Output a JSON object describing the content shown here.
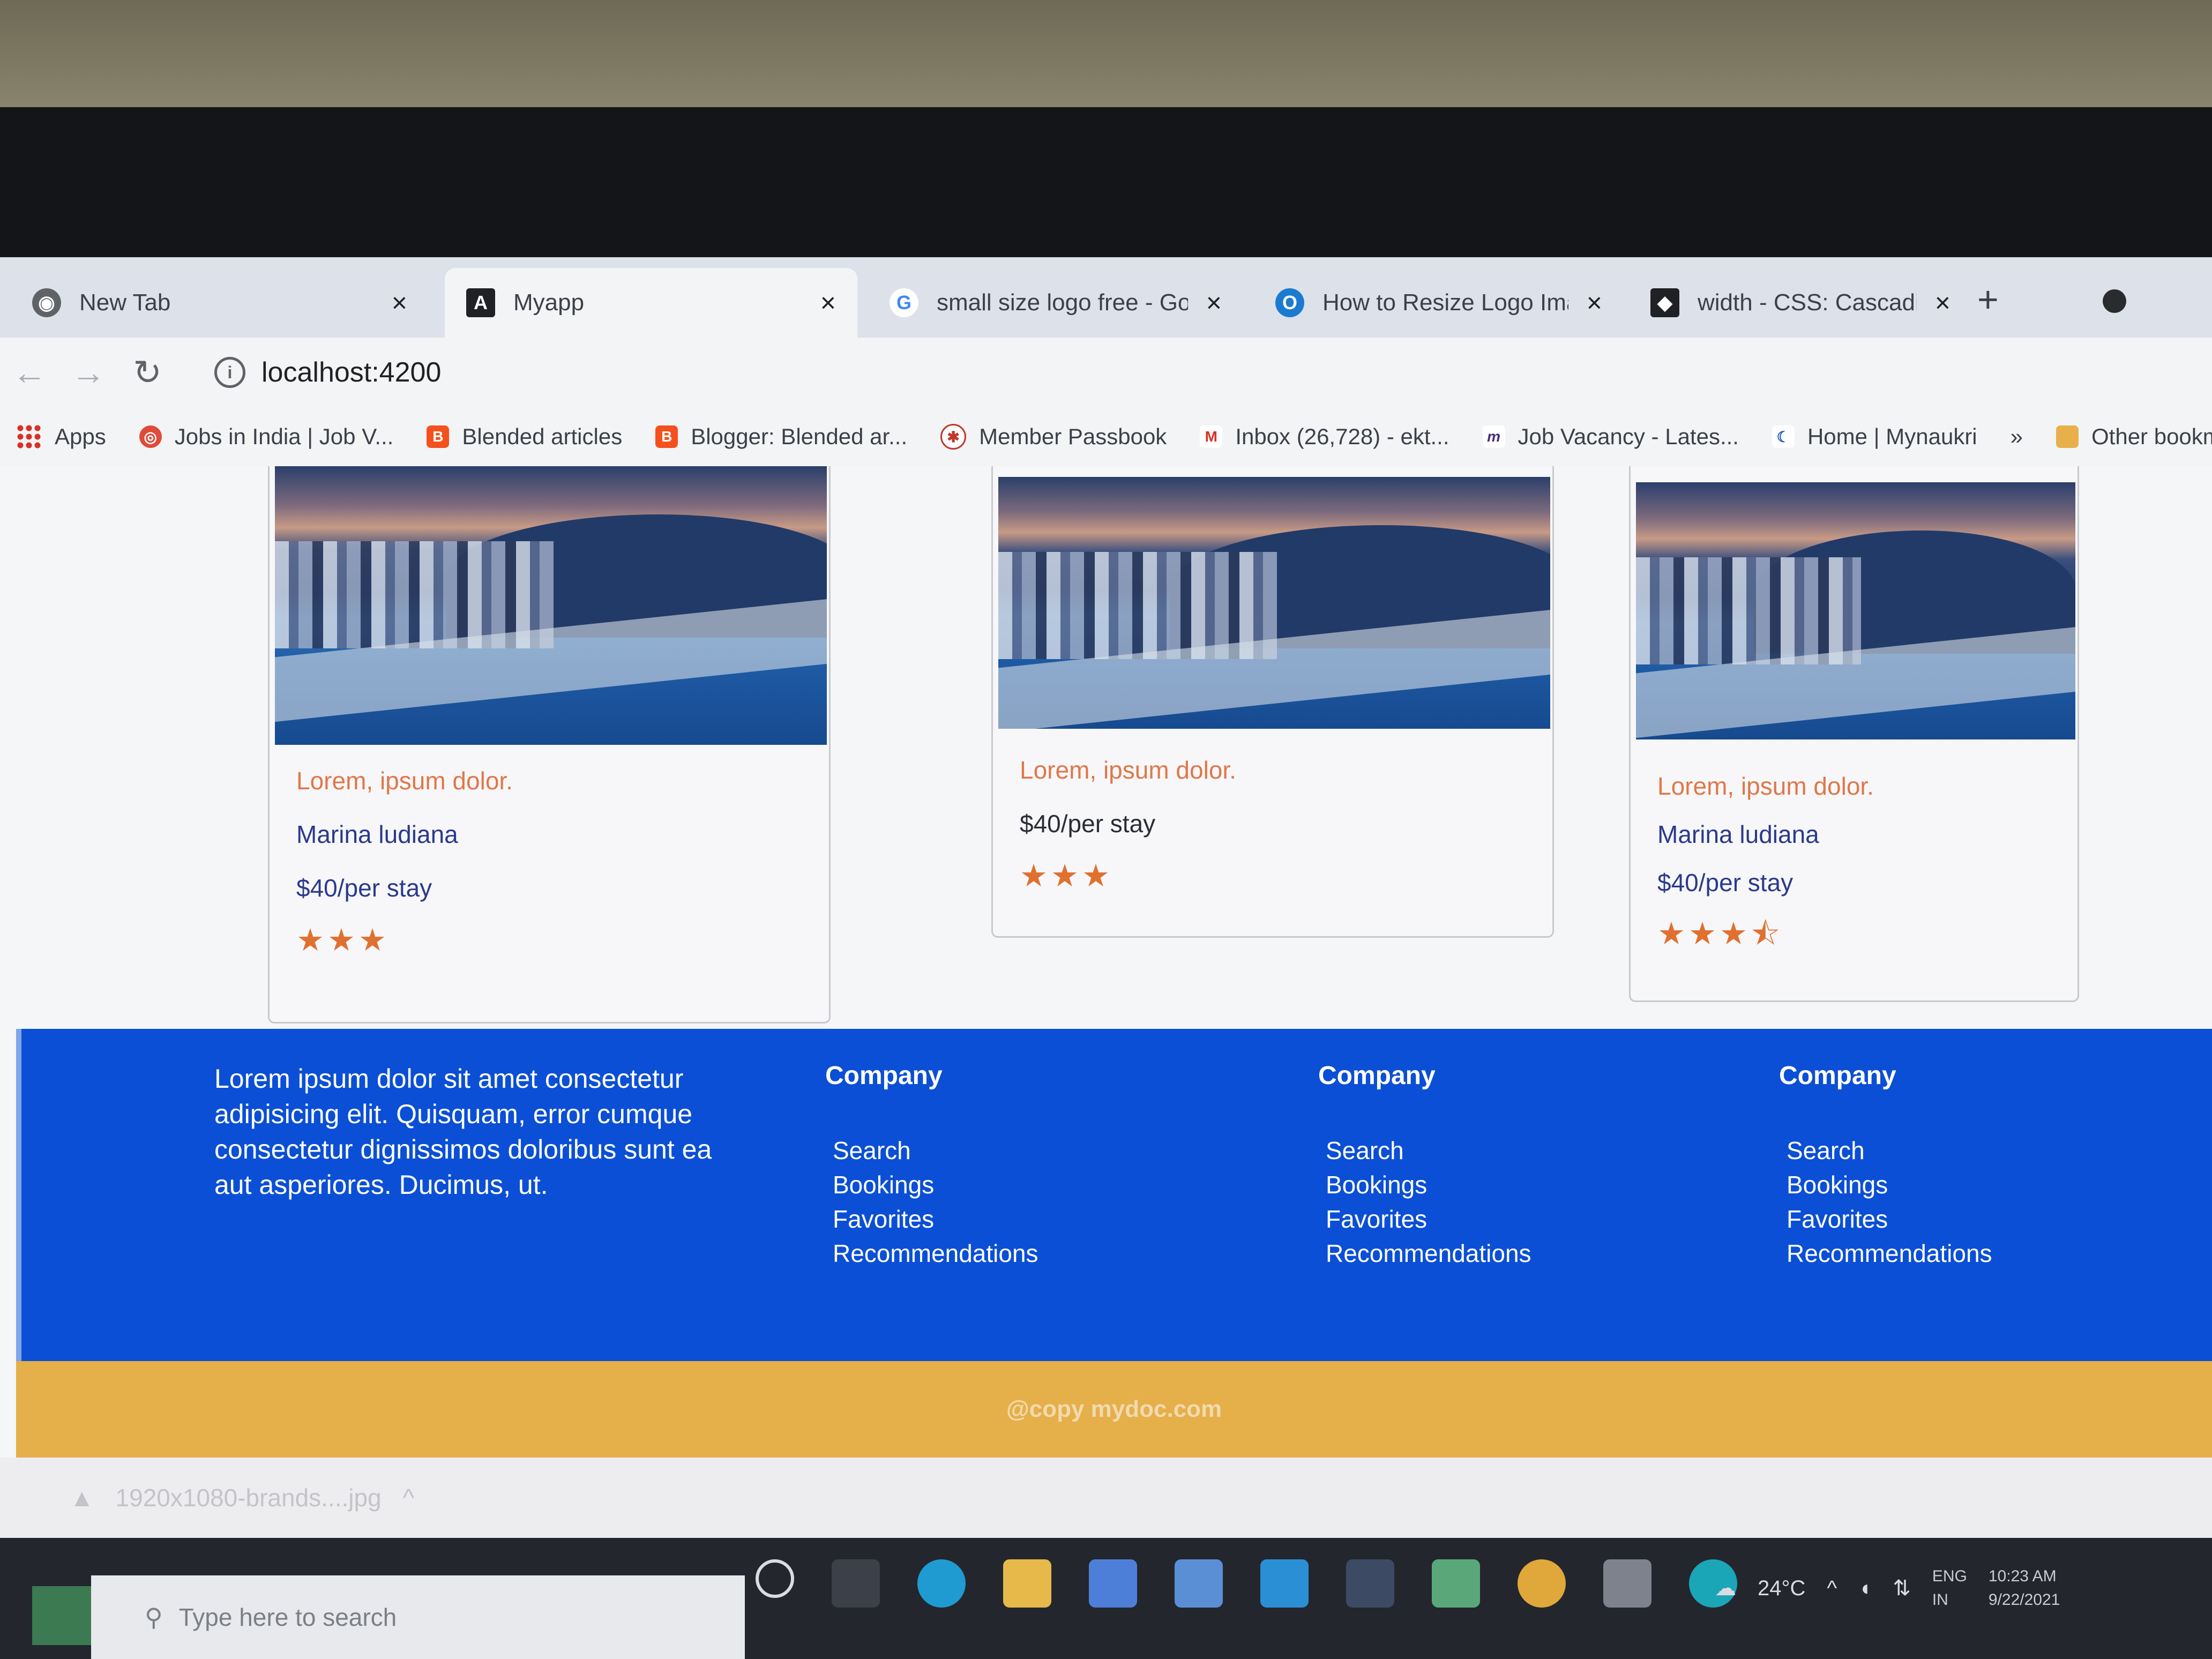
{
  "browser": {
    "tabs": [
      {
        "title": "New Tab",
        "icon": "chrome-icon",
        "active": false
      },
      {
        "title": "Myapp",
        "icon": "angular-icon",
        "active": true
      },
      {
        "title": "small size logo free - Google",
        "icon": "google-icon",
        "active": false
      },
      {
        "title": "How to Resize Logo Image in",
        "icon": "site-icon",
        "active": false
      },
      {
        "title": "width - CSS: Cascading Style",
        "icon": "mdn-icon",
        "active": false
      }
    ],
    "address": "localhost:4200",
    "bookmarks": [
      {
        "label": "Apps",
        "icon": "apps-grid-icon"
      },
      {
        "label": "Jobs in India | Job V...",
        "icon": "jobs-icon"
      },
      {
        "label": "Blended articles",
        "icon": "blogger-icon"
      },
      {
        "label": "Blogger: Blended ar...",
        "icon": "blogger-icon"
      },
      {
        "label": "Member Passbook",
        "icon": "epfo-icon"
      },
      {
        "label": "Inbox (26,728) - ekt...",
        "icon": "gmail-icon"
      },
      {
        "label": "Job Vacancy - Lates...",
        "icon": "m-icon"
      },
      {
        "label": "Home | Mynaukri",
        "icon": "mynaukri-icon"
      }
    ],
    "bookmarks_overflow": "»",
    "other_bookmarks": "Other bookmarks"
  },
  "cards": [
    {
      "title": "Lorem, ipsum dolor.",
      "name": "Marina ludiana",
      "price": "$40/per stay",
      "rating": 3,
      "stars": "★★★"
    },
    {
      "title": "Lorem, ipsum dolor.",
      "name": "",
      "price": "$40/per stay",
      "rating": 3,
      "stars": "★★★"
    },
    {
      "title": "Lorem, ipsum dolor.",
      "name": "Marina ludiana",
      "price": "$40/per stay",
      "rating": 3.5,
      "stars": "★★★⯪"
    }
  ],
  "footer": {
    "about": "Lorem ipsum dolor sit amet consectetur adipisicing elit. Quisquam, error cumque consectetur dignissimos doloribus sunt ea aut asperiores. Ducimus, ut.",
    "columns": [
      {
        "heading": "Company",
        "links": [
          "Search",
          "Bookings",
          "Favorites",
          "Recommendations"
        ]
      },
      {
        "heading": "Company",
        "links": [
          "Search",
          "Bookings",
          "Favorites",
          "Recommendations"
        ]
      },
      {
        "heading": "Company",
        "links": [
          "Search",
          "Bookings",
          "Favorites",
          "Recommendations"
        ]
      }
    ],
    "copyright": "@copy mydoc.com"
  },
  "download_shelf": {
    "file": "1920x1080-brands....jpg"
  },
  "taskbar": {
    "search_placeholder": "Type here to search",
    "temperature": "24°C",
    "language": "ENG",
    "region": "IN",
    "time": "10:23 AM",
    "date": "9/22/2021"
  },
  "colors": {
    "footer_bg": "#0b4fd6",
    "copyright_bg": "#e5b049",
    "card_title": "#e07748",
    "card_text": "#2b3a8c",
    "star": "#e07030"
  }
}
